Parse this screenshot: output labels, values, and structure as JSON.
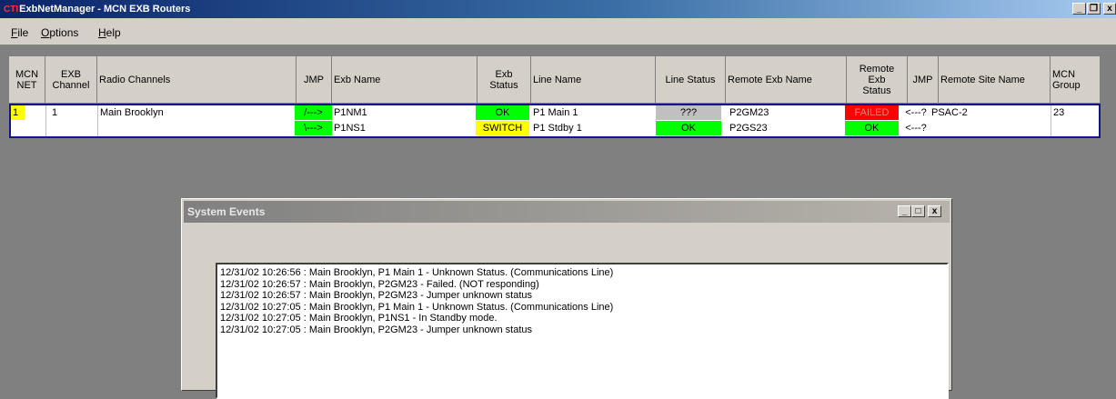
{
  "window": {
    "logo": "CTI",
    "title": "ExbNetManager - MCN EXB Routers",
    "controls": [
      "_",
      "ͦ",
      "x"
    ]
  },
  "menu": [
    {
      "label": "File",
      "accel": "F",
      "rest": "ile"
    },
    {
      "label": "Options",
      "accel": "O",
      "rest": "ptions"
    },
    {
      "label": "Help",
      "accel": "H",
      "rest": "elp"
    }
  ],
  "grid": {
    "headers": {
      "mcn_net": [
        "MCN",
        "NET"
      ],
      "exb_channel": [
        "EXB",
        "Channel"
      ],
      "radio_channels": "Radio Channels",
      "jmp": "JMP",
      "exb_name": "Exb Name",
      "exb_status": [
        "Exb",
        "Status"
      ],
      "line_name": "Line Name",
      "line_status": "Line Status",
      "remote_exb_name": "Remote Exb Name",
      "remote_exb_status": [
        "Remote",
        "Exb",
        "Status"
      ],
      "jmp2": "JMP",
      "remote_site_name": "Remote Site Name",
      "mcn_group": [
        "MCN",
        "Group"
      ]
    },
    "row": {
      "mcn_net": "1",
      "exb_channel": "1",
      "radio_channel": "Main Brooklyn",
      "remote_site": "PSAC-2",
      "mcn_group": "23",
      "lines": [
        {
          "jmp": "/--->",
          "exb_name": "P1NM1",
          "exb_status": "OK",
          "line_name": "P1 Main 1",
          "line_status": "???",
          "remote_exb_name": "P2GM23",
          "remote_exb_status": "FAILED",
          "jmp2": "<---?"
        },
        {
          "jmp": "\\--->",
          "exb_name": "P1NS1",
          "exb_status": "SWITCH",
          "line_name": "P1 Stdby 1",
          "line_status": "OK",
          "remote_exb_name": "P2GS23",
          "remote_exb_status": "OK",
          "jmp2": "<---?"
        }
      ]
    },
    "colors": {
      "green": "#00ff00",
      "yellow": "#ffff00",
      "red": "#ff0000",
      "gray": "#c0c0c0"
    }
  },
  "system_events": {
    "title": "System Events",
    "controls": [
      "_",
      "□",
      "x"
    ],
    "lines": [
      "12/31/02 10:26:56 : Main Brooklyn, P1 Main 1 - Unknown Status. (Communications Line)",
      "12/31/02 10:26:57 : Main Brooklyn, P2GM23 - Failed. (NOT responding)",
      "12/31/02 10:26:57 : Main Brooklyn, P2GM23 - Jumper unknown status",
      "12/31/02 10:27:05 : Main Brooklyn, P1 Main 1 - Unknown Status. (Communications Line)",
      "12/31/02 10:27:05 : Main Brooklyn, P1NS1 - In Standby mode.",
      "12/31/02 10:27:05 : Main Brooklyn, P2GM23 - Jumper unknown status"
    ]
  }
}
